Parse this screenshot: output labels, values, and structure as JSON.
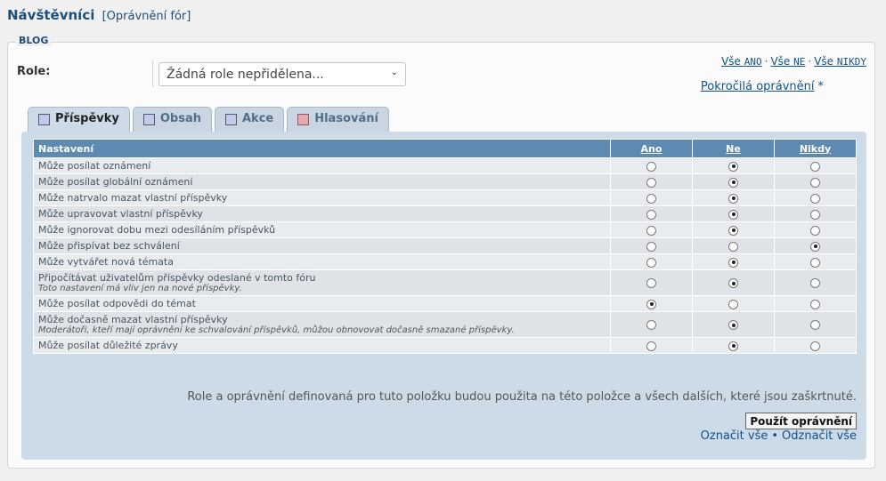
{
  "header": {
    "title": "Návštěvníci",
    "subtitle": "[Oprávnění fór]"
  },
  "section": {
    "legend": "BLOG"
  },
  "role": {
    "label": "Role:",
    "selected": "Žádná role nepřidělena..."
  },
  "quick": {
    "all_yes": "Vše ANO",
    "all_no": "Vše NE",
    "all_never": "Vše NIKDY",
    "advanced": "Pokročilá oprávnění",
    "star": "*",
    "sep": "·"
  },
  "tabs": [
    {
      "label": "Příspěvky",
      "color": "#c3c9ea"
    },
    {
      "label": "Obsah",
      "color": "#c3c9ea"
    },
    {
      "label": "Akce",
      "color": "#c3c9ea"
    },
    {
      "label": "Hlasování",
      "color": "#e8a8b0"
    }
  ],
  "table": {
    "headers": {
      "setting": "Nastavení",
      "yes": "Ano",
      "no": "Ne",
      "never": "Nikdy"
    },
    "rows": [
      {
        "label": "Může posílat oznámení",
        "value": "no"
      },
      {
        "label": "Může posílat globální oznámení",
        "value": "no"
      },
      {
        "label": "Může natrvalo mazat vlastní příspěvky",
        "value": "no"
      },
      {
        "label": "Může upravovat vlastní příspěvky",
        "value": "no"
      },
      {
        "label": "Může ignorovat dobu mezi odesíláním příspěvků",
        "value": "no"
      },
      {
        "label": "Může přispívat bez schválení",
        "value": "never"
      },
      {
        "label": "Může vytvářet nová témata",
        "value": "no"
      },
      {
        "label": "Připočítávat uživatelům příspěvky odeslané v tomto fóru",
        "explain": "Toto nastavení má vliv jen na nové příspěvky.",
        "value": "no"
      },
      {
        "label": "Může posílat odpovědi do témat",
        "value": "yes"
      },
      {
        "label": "Může dočasně mazat vlastní příspěvky",
        "explain": "Moderátoři, kteří mají oprávnění ke schvalování příspěvků, můžou obnovovat dočasně smazané příspěvky.",
        "value": "no"
      },
      {
        "label": "Může posílat důležité zprávy",
        "value": "no"
      }
    ]
  },
  "footer": {
    "note": "Role a oprávnění definovaná pro tuto položku budou použita na této položce a všech dalších, které jsou zaškrtnuté.",
    "apply": "Použít oprávnění",
    "mark_all": "Označit vše",
    "unmark_all": "Odznačit vše",
    "bullet": "•"
  }
}
